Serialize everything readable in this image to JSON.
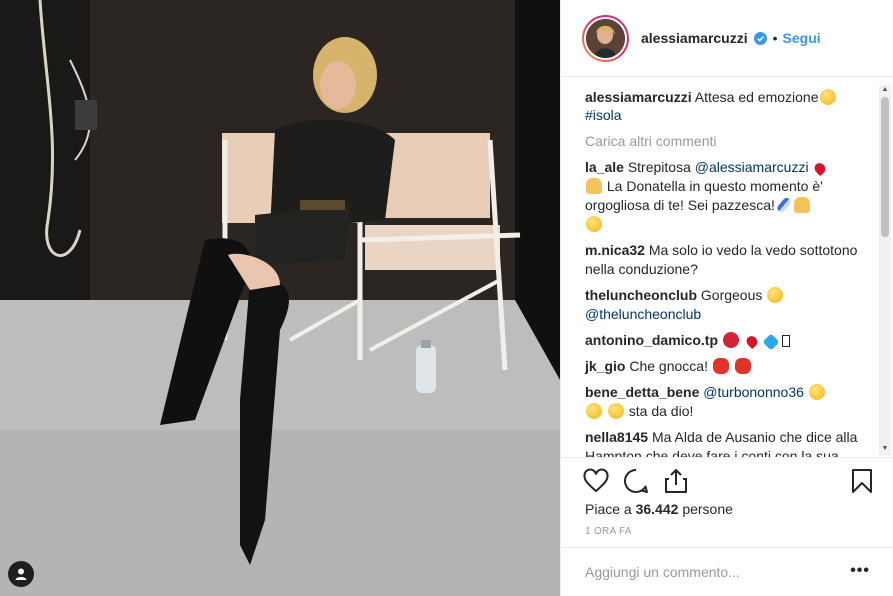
{
  "header": {
    "username": "alessiamarcuzzi",
    "verified_icon": "verified-badge-icon",
    "separator": "•",
    "follow_label": "Segui"
  },
  "caption": {
    "username": "alessiamarcuzzi",
    "text": "Attesa ed emozione",
    "hashtag": "#isola"
  },
  "load_more_label": "Carica altri commenti",
  "comments": [
    {
      "username": "la_ale",
      "text_a": "Strepitosa",
      "mention": "@alessiamarcuzzi",
      "text_b": "La Donatella in questo momento è' orgogliosa di te! Sei pazzesca!"
    },
    {
      "username": "m.nica32",
      "text_a": "Ma solo io vedo la vedo sottotono nella conduzione?"
    },
    {
      "username": "theluncheonclub",
      "text_a": "Gorgeous",
      "mention": "@theluncheonclub"
    },
    {
      "username": "antonino_damico.tp",
      "text_a": ""
    },
    {
      "username": "jk_gio",
      "text_a": "Che gnocca!"
    },
    {
      "username": "bene_detta_bene",
      "mention": "@turbononno36",
      "text_b": "sta da dio!"
    },
    {
      "username": "nella8145",
      "text_a": "Ma Alda de Ausanio che dice alla Hampton che deve fare i conti con la sua bellezza sfiorita non si può"
    }
  ],
  "actions": {
    "like_icon": "heart-icon",
    "comment_icon": "comment-icon",
    "share_icon": "share-icon",
    "save_icon": "bookmark-icon"
  },
  "likes": {
    "prefix": "Piace a",
    "count": "36.442",
    "suffix": "persone"
  },
  "time_ago": "1 ORA FA",
  "add_comment": {
    "placeholder": "Aggiungi un commento...",
    "more_label": "•••"
  },
  "colors": {
    "link": "#3897f0",
    "mention": "#003569",
    "secondary_text": "#999999",
    "border": "#efefef"
  }
}
